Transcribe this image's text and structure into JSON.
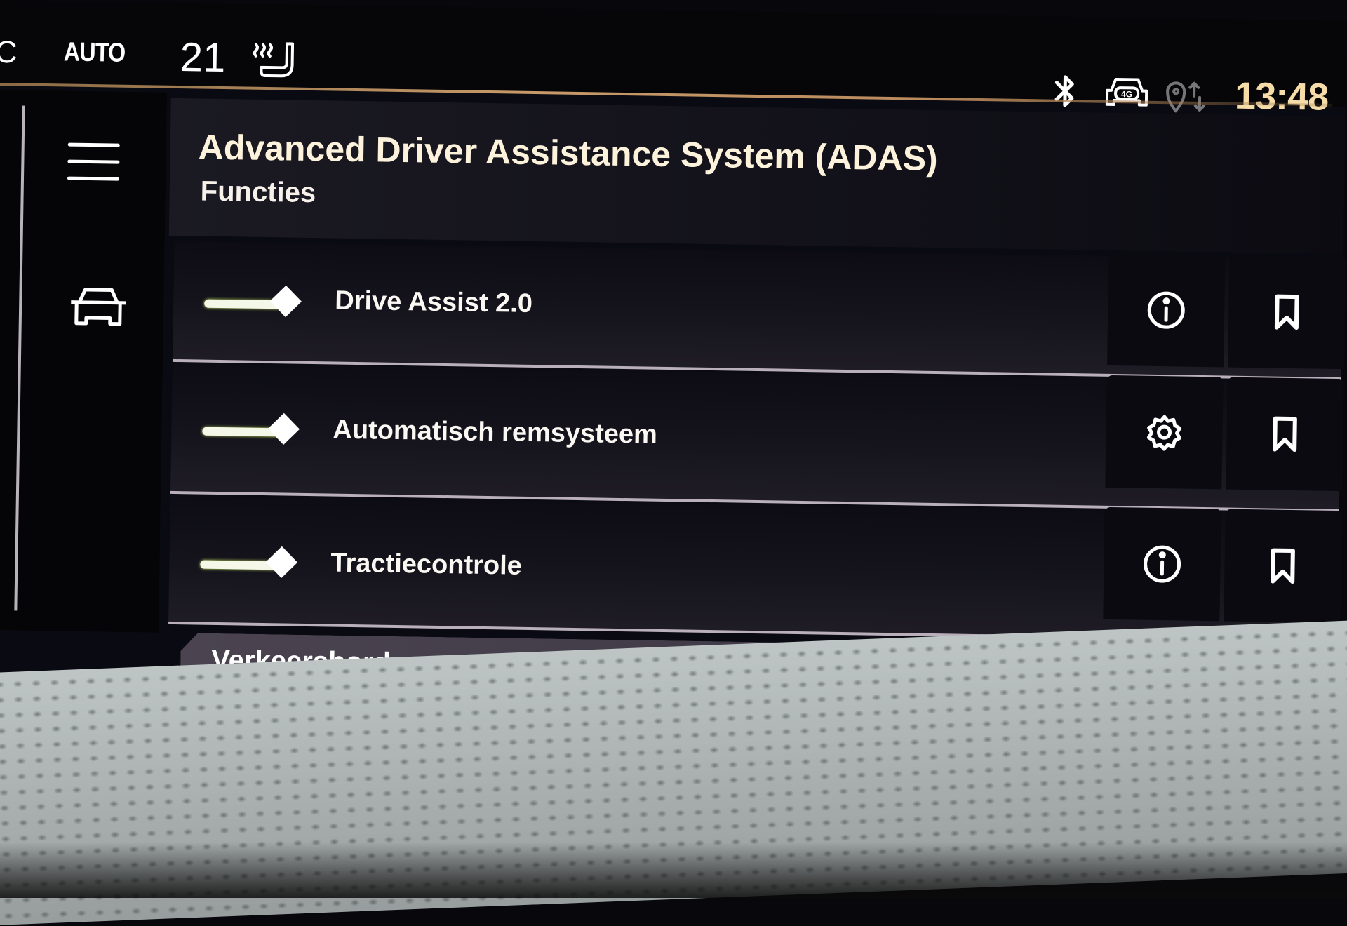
{
  "status_bar": {
    "climate_partial": "C",
    "climate_mode": "AUTO",
    "temperature": "21",
    "seat_heating_icon": "seat-heating-icon",
    "bluetooth_icon": "bluetooth-icon",
    "connectivity_icon": "car-4g-icon",
    "connectivity_label": "4G",
    "location_icon": "location-sharing-icon",
    "time": "13:48"
  },
  "sidebar": {
    "menu_icon": "hamburger-menu-icon",
    "vehicle_icon": "car-icon"
  },
  "header": {
    "title": "Advanced Driver Assistance System (ADAS)",
    "subtitle": "Functies"
  },
  "functions": [
    {
      "label": "Drive Assist 2.0",
      "enabled": true,
      "action_icon": "info-icon",
      "favorite_icon": "bookmark-icon"
    },
    {
      "label": "Automatisch remsysteem",
      "enabled": true,
      "action_icon": "gear-icon",
      "favorite_icon": "bookmark-icon"
    },
    {
      "label": "Tractiecontrole",
      "enabled": true,
      "action_icon": "info-icon",
      "favorite_icon": "bookmark-icon"
    }
  ],
  "next_section": {
    "label": "Verkeersborden"
  },
  "colors": {
    "accent_gold": "#c89a6a",
    "time_color": "#f6dca8",
    "toggle_on_glow": "#c7e860",
    "background": "#0a0a12"
  }
}
